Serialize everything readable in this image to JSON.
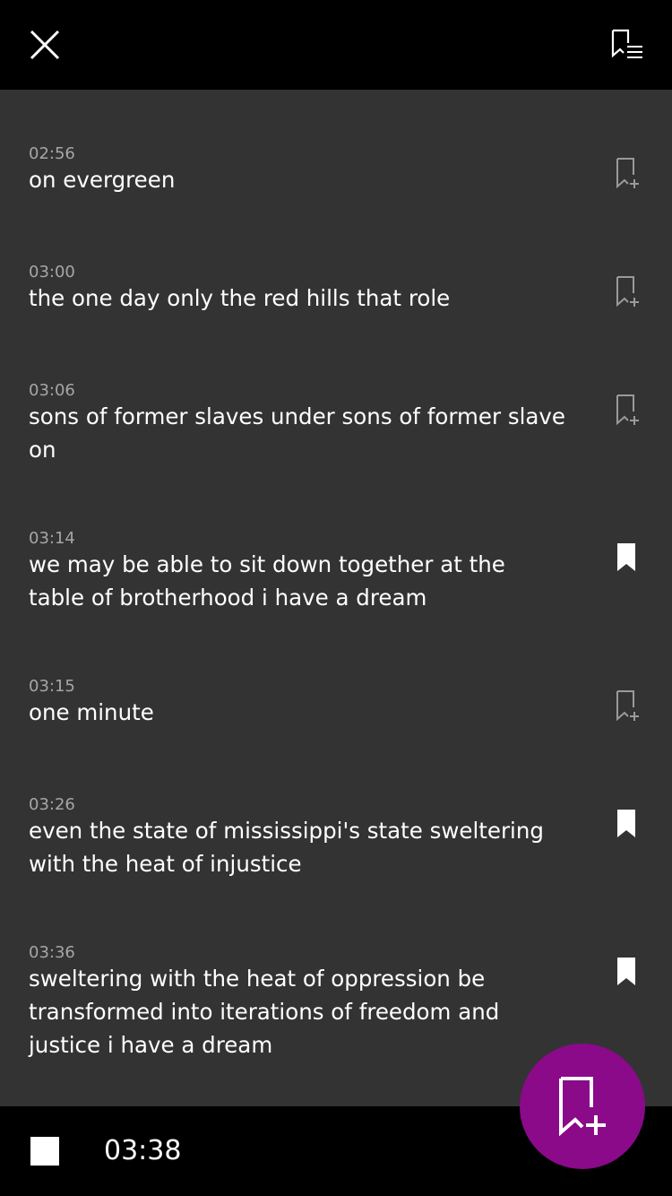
{
  "app": {
    "accent_color": "#8a0a8a",
    "background_color": "#333333",
    "bar_color": "#000000"
  },
  "top_bar": {
    "close_icon": "close-icon",
    "bookmarks_list_icon": "bookmark-list-icon"
  },
  "entries": [
    {
      "time": "02:56",
      "text": "on evergreen",
      "bookmarked": false
    },
    {
      "time": "03:00",
      "text": "the one day only the red hills that role",
      "bookmarked": false
    },
    {
      "time": "03:06",
      "text": "sons of former slaves under sons of former slave on",
      "bookmarked": false
    },
    {
      "time": "03:14",
      "text": "we may be able to sit down together at the table of brotherhood i have a dream",
      "bookmarked": true
    },
    {
      "time": "03:15",
      "text": "one minute",
      "bookmarked": false
    },
    {
      "time": "03:26",
      "text": "even the state of mississippi's state sweltering with the heat of injustice",
      "bookmarked": true
    },
    {
      "time": "03:36",
      "text": "sweltering with the heat of oppression be transformed into iterations of freedom and justice i have a dream",
      "bookmarked": true
    }
  ],
  "bottom_bar": {
    "stop_icon": "stop-icon",
    "elapsed": "03:38",
    "add_bookmark_icon": "add-bookmark-icon"
  }
}
